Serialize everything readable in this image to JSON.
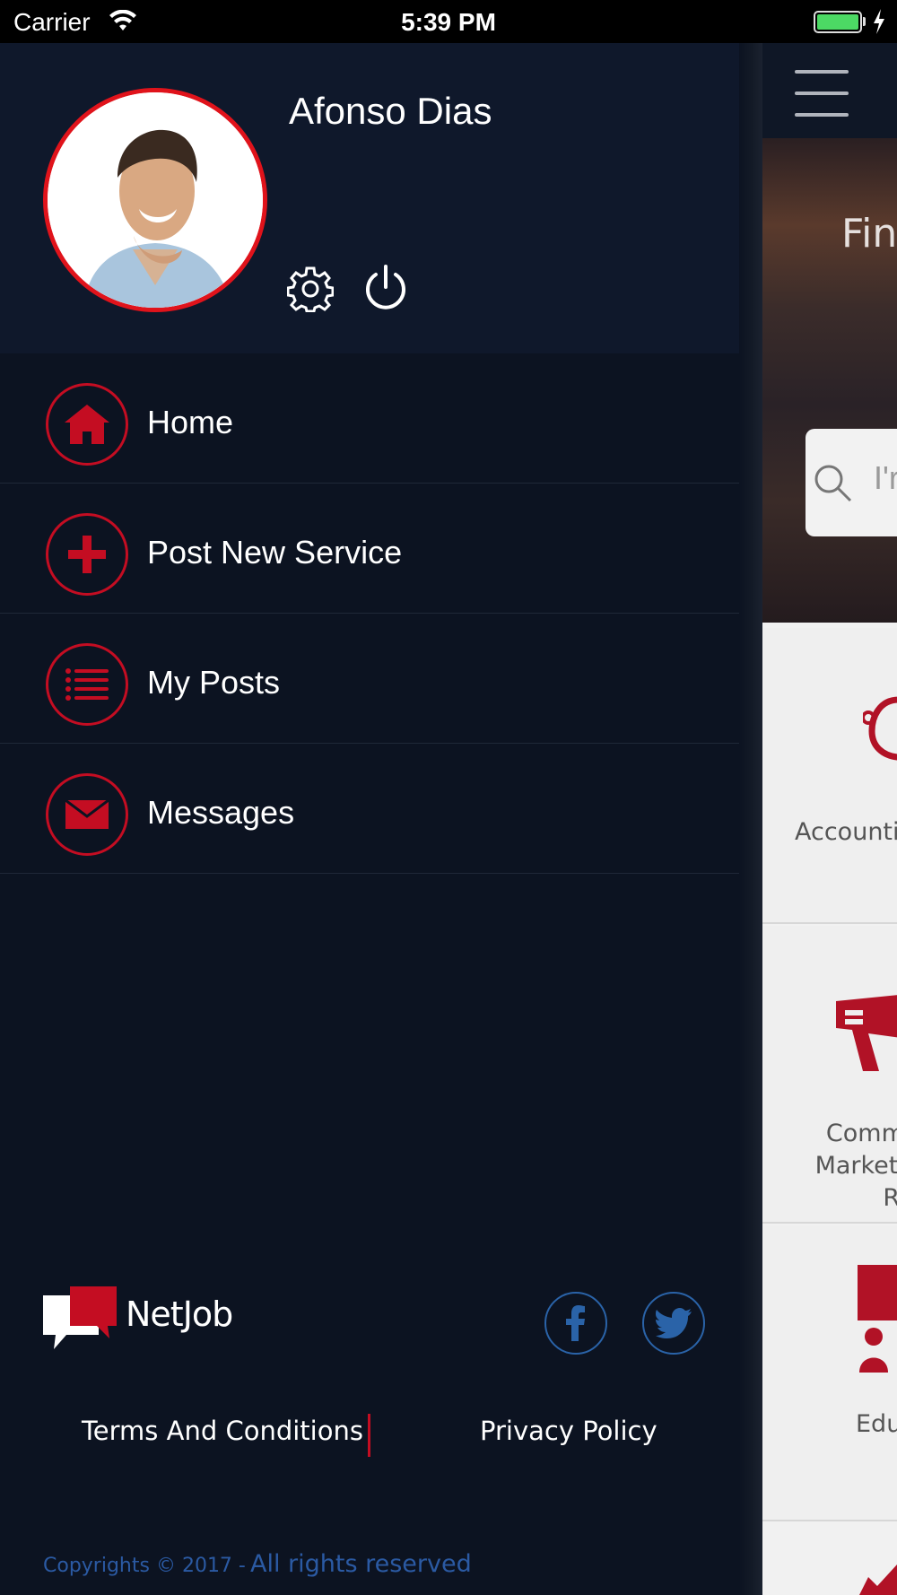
{
  "status_bar": {
    "carrier": "Carrier",
    "time": "5:39 PM",
    "battery_level": 1.0,
    "battery_color": "#4cd964"
  },
  "profile": {
    "name": "Afonso Dias",
    "avatar_border_color": "#e0131b",
    "actions": [
      {
        "icon": "gear-icon"
      },
      {
        "icon": "power-icon"
      }
    ]
  },
  "menu": {
    "accent_color": "#c40d22",
    "items": [
      {
        "label": "Home",
        "icon": "home-icon"
      },
      {
        "label": "Post New Service",
        "icon": "plus-icon"
      },
      {
        "label": "My Posts",
        "icon": "list-icon"
      },
      {
        "label": "Messages",
        "icon": "envelope-icon"
      }
    ]
  },
  "brand": {
    "name": "NetJob"
  },
  "social": [
    {
      "icon": "facebook-icon",
      "color": "#2a63a8"
    },
    {
      "icon": "twitter-icon",
      "color": "#2a63a8"
    }
  ],
  "footer": {
    "terms_label": "Terms And Conditions",
    "privacy_label": "Privacy Policy",
    "copyright_prefix": "Copyrights © 2017 -",
    "copyright_suffix": "All rights reserved"
  },
  "background_screen": {
    "hero_title": "Fin",
    "search_placeholder": "I'r",
    "categories": [
      {
        "label": "Accountin"
      },
      {
        "label": "Commu\nMarketin\nRel"
      },
      {
        "label": "Edu"
      }
    ]
  }
}
